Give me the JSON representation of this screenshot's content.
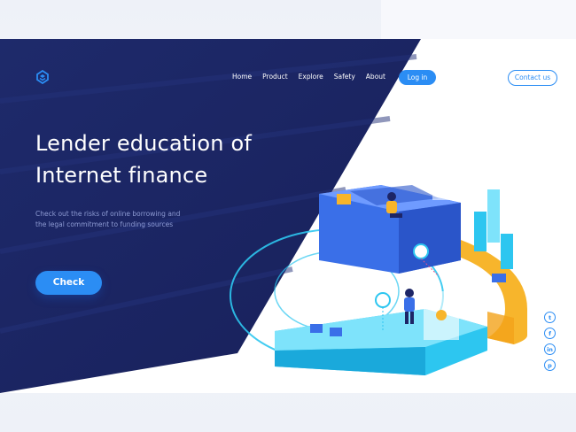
{
  "nav": {
    "items": [
      {
        "label": "Home"
      },
      {
        "label": "Product"
      },
      {
        "label": "Explore"
      },
      {
        "label": "Safety"
      },
      {
        "label": "About"
      }
    ],
    "login_label": "Log in",
    "contact_label": "Contact us"
  },
  "hero": {
    "title_line1": "Lender education of",
    "title_line2": "Internet finance",
    "subtitle_line1": "Check out the risks of online borrowing and",
    "subtitle_line2": "the legal commitment to funding sources",
    "cta_label": "Check"
  },
  "social": [
    {
      "icon": "twitter-icon",
      "glyph": "t"
    },
    {
      "icon": "facebook-icon",
      "glyph": "f"
    },
    {
      "icon": "linkedin-icon",
      "glyph": "in"
    },
    {
      "icon": "pinterest-icon",
      "glyph": "p"
    }
  ],
  "colors": {
    "navy": "#1d2566",
    "accent": "#2b8df4",
    "yellow": "#f7b52c",
    "cyan": "#2dc6f0"
  }
}
